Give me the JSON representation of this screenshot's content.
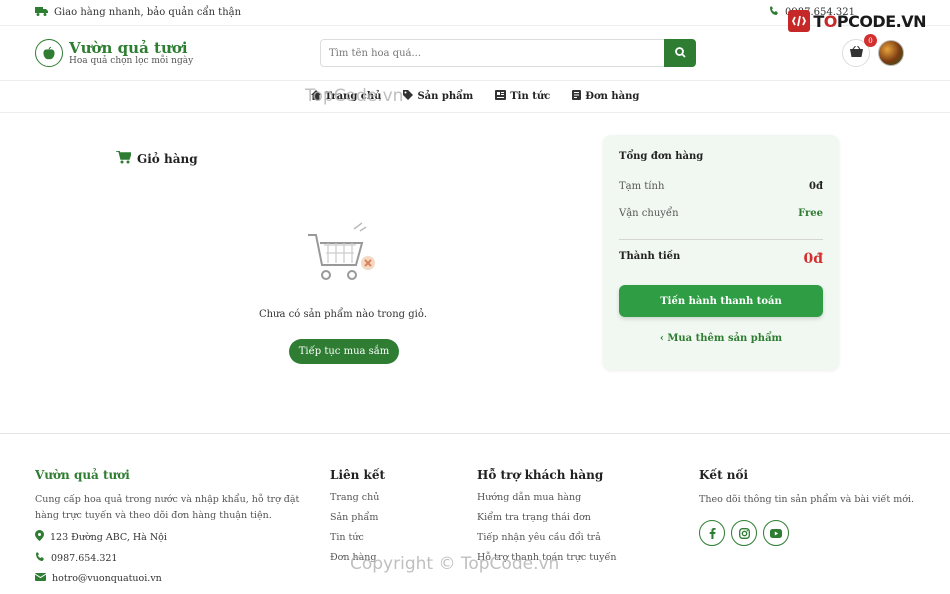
{
  "topbar": {
    "shipping_text": "Giao hàng nhanh, bảo quản cẩn thận",
    "phone": "0987.654.321"
  },
  "header": {
    "logo_title": "Vườn quả tươi",
    "logo_subtitle": "Hoa quả chọn lọc mỗi ngày",
    "search_placeholder": "Tìm tên hoa quả...",
    "cart_count": "0",
    "brand": {
      "name_a": "T",
      "name_o": "O",
      "name_b": "PCODE.VN"
    }
  },
  "nav": {
    "items": [
      {
        "label": "Trang chủ"
      },
      {
        "label": "Sản phẩm"
      },
      {
        "label": "Tin tức"
      },
      {
        "label": "Đơn hàng"
      }
    ]
  },
  "cart": {
    "title": "Giỏ hàng",
    "empty_text": "Chưa có sản phẩm nào trong giỏ.",
    "continue_label": "Tiếp tục mua sắm"
  },
  "summary": {
    "title": "Tổng đơn hàng",
    "subtotal_label": "Tạm tính",
    "subtotal_value": "0đ",
    "shipping_label": "Vận chuyển",
    "shipping_value": "Free",
    "total_label": "Thành tiền",
    "total_value": "0đ",
    "checkout_label": "Tiến hành thanh toán",
    "more_label": "Mua thêm sản phẩm"
  },
  "footer": {
    "about_title": "Vườn quả tươi",
    "about_text": "Cung cấp hoa quả trong nước và nhập khẩu, hỗ trợ đặt hàng trực tuyến và theo dõi đơn hàng thuận tiện.",
    "address": "123 Đường ABC, Hà Nội",
    "phone": "0987.654.321",
    "email": "hotro@vuonquatuoi.vn",
    "links_title": "Liên kết",
    "links": [
      "Trang chủ",
      "Sản phẩm",
      "Tin tức",
      "Đơn hàng"
    ],
    "support_title": "Hỗ trợ khách hàng",
    "support": [
      "Hướng dẫn mua hàng",
      "Kiểm tra trạng thái đơn",
      "Tiếp nhận yêu cầu đổi trả",
      "Hỗ trợ thanh toán trực tuyến"
    ],
    "connect_title": "Kết nối",
    "connect_text": "Theo dõi thông tin sản phẩm và bài viết mới."
  },
  "watermarks": {
    "top": "TopCode.vn",
    "bottom": "Copyright © TopCode.vn"
  },
  "colors": {
    "primary": "#2e7d32",
    "accent_red": "#d32f2f",
    "summary_bg": "#f1f8f1"
  }
}
